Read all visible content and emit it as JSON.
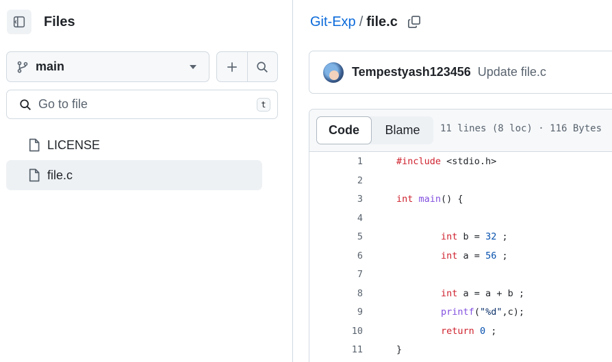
{
  "sidebar": {
    "title": "Files",
    "branch": "main",
    "search_placeholder": "Go to file",
    "search_shortcut": "t",
    "items": [
      {
        "name": "LICENSE",
        "active": false
      },
      {
        "name": "file.c",
        "active": true
      }
    ]
  },
  "breadcrumb": {
    "repo": "Git-Exp",
    "separator": "/",
    "file": "file.c"
  },
  "commit": {
    "author": "Tempestyash123456",
    "message": "Update file.c"
  },
  "file_view": {
    "tabs": [
      "Code",
      "Blame"
    ],
    "active_tab": "Code",
    "meta": "11 lines (8 loc) · 116 Bytes"
  },
  "code": {
    "lines": [
      {
        "n": "1",
        "text": "#include <stdio.h>"
      },
      {
        "n": "2",
        "text": ""
      },
      {
        "n": "3",
        "text": "int main() {"
      },
      {
        "n": "4",
        "text": ""
      },
      {
        "n": "5",
        "text": "        int b = 32 ;"
      },
      {
        "n": "6",
        "text": "        int a = 56 ;"
      },
      {
        "n": "7",
        "text": ""
      },
      {
        "n": "8",
        "text": "        int a = a + b ;"
      },
      {
        "n": "9",
        "text": "        printf(\"%d\",c);"
      },
      {
        "n": "10",
        "text": "        return 0 ;"
      },
      {
        "n": "11",
        "text": "}"
      }
    ]
  },
  "colors": {
    "link": "#0969da",
    "keyword": "#cf222e",
    "function": "#8250df",
    "number": "#0550ae",
    "border": "#d1d9e0"
  }
}
